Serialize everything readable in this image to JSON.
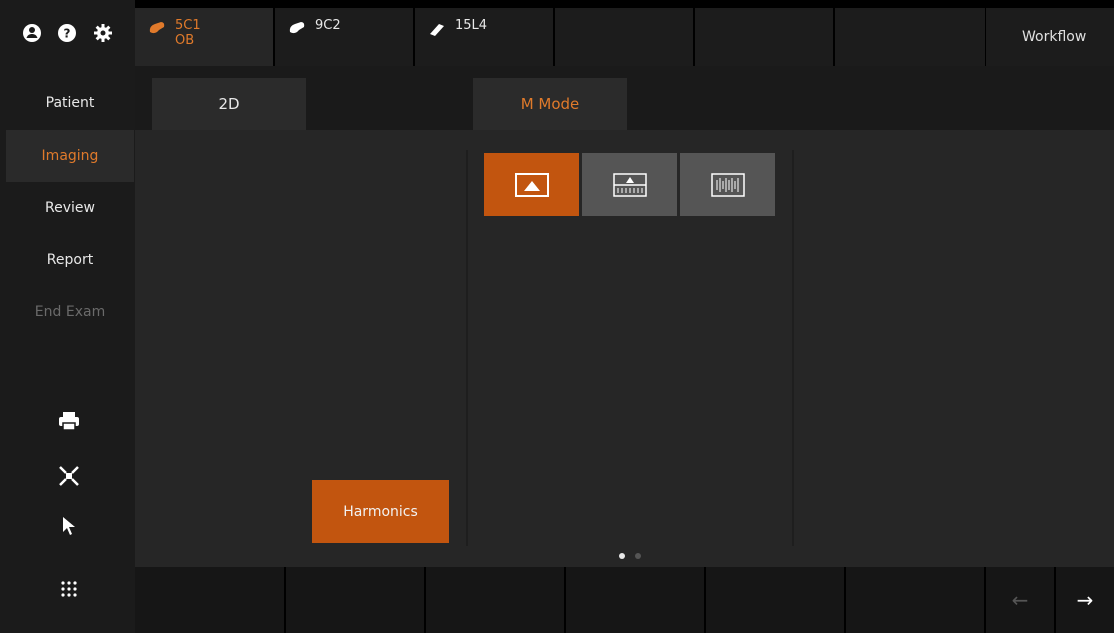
{
  "top_icons": {
    "user_icon": "user-icon",
    "help_icon": "help-icon",
    "settings_icon": "gear-icon"
  },
  "probes": [
    {
      "model": "5C1",
      "preset": "OB",
      "active": true
    },
    {
      "model": "9C2",
      "preset": "",
      "active": false
    },
    {
      "model": "15L4",
      "preset": "",
      "active": false
    }
  ],
  "workflow_label": "Workflow",
  "sidebar": {
    "items": [
      {
        "label": "Patient"
      },
      {
        "label": "Imaging"
      },
      {
        "label": "Review"
      },
      {
        "label": "Report"
      },
      {
        "label": "End Exam"
      }
    ],
    "tools": [
      "print-icon",
      "fullscreen-icon",
      "pointer-icon",
      "grid-menu-icon"
    ]
  },
  "tabs": [
    {
      "label": "2D"
    },
    {
      "label": "M Mode"
    }
  ],
  "mmode_layouts": [
    "2d-only",
    "2d-over-mmode",
    "mmode-only"
  ],
  "harmonics_label": "Harmonics",
  "pager": {
    "current": 1,
    "total": 2
  },
  "nav": {
    "back": "←",
    "forward": "→"
  },
  "colors": {
    "accent": "#e07a2b",
    "active_fill": "#c2550f"
  }
}
